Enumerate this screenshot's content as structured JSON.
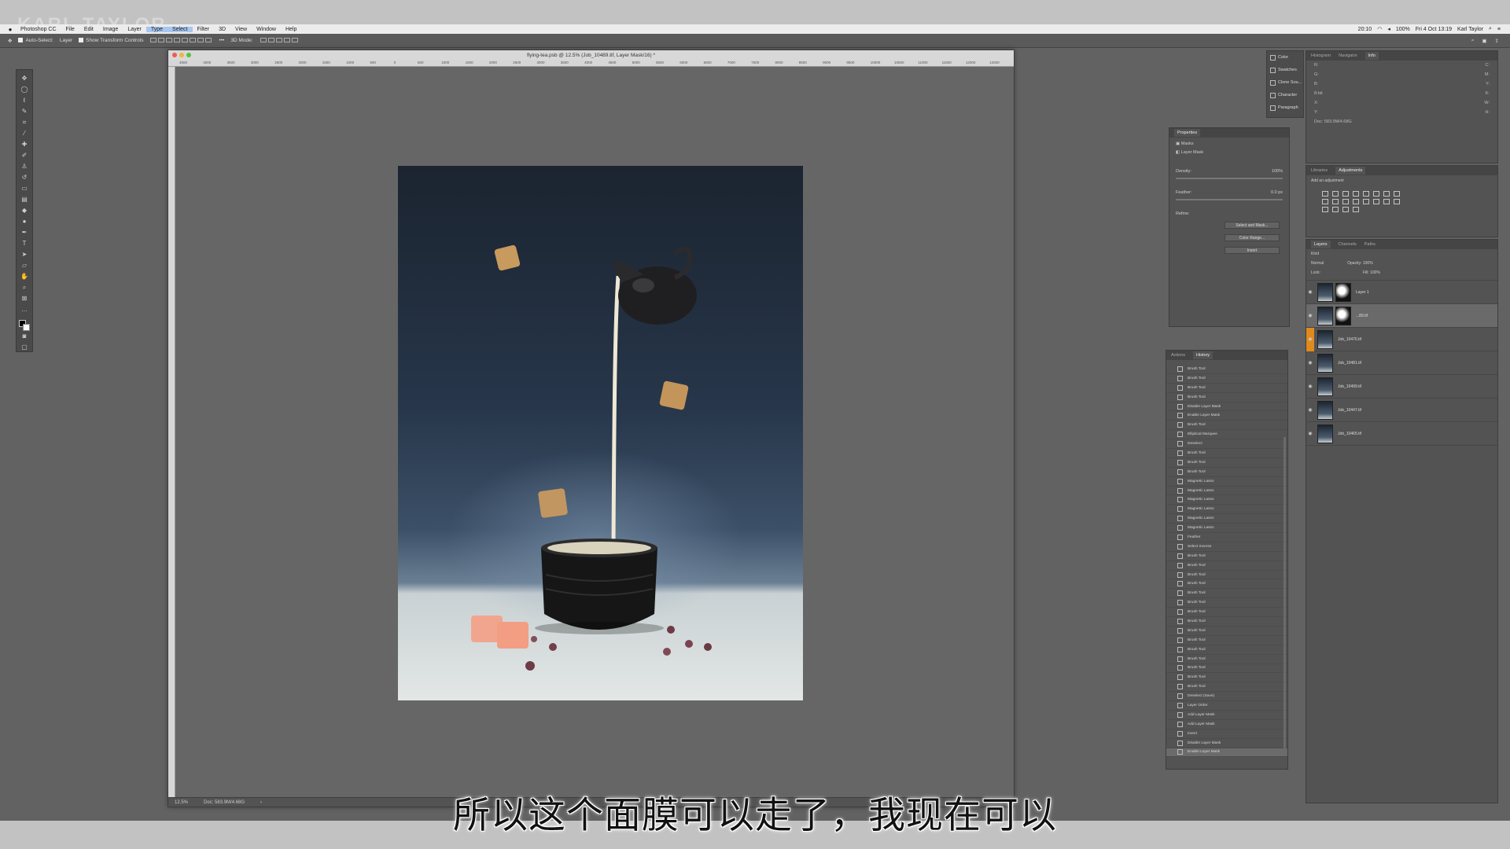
{
  "watermark": "KARL TAYLOR",
  "menubar": {
    "items": [
      "Photoshop CC",
      "File",
      "Edit",
      "Image",
      "Layer",
      "Type",
      "Select",
      "Filter",
      "3D",
      "View",
      "Window",
      "Help"
    ],
    "status": {
      "time_small": "20:10",
      "battery": "100%",
      "date": "Fri 4 Oct 13:19",
      "user": "Karl Taylor"
    }
  },
  "optionsbar": {
    "auto_select": "Auto-Select:",
    "layer_select": "Layer",
    "transform": "Show Transform Controls",
    "mode3d": "3D Mode:"
  },
  "document": {
    "title": "flying-tea.psb @ 12.5% (Job_10489.tif, Layer Mask/16) *",
    "zoom": "12.5%",
    "doc_size": "Doc: 583.9M/4.68G",
    "ruler_labels": [
      "4500",
      "4000",
      "3500",
      "3000",
      "2500",
      "2000",
      "1500",
      "1000",
      "500",
      "0",
      "500",
      "1000",
      "1500",
      "2000",
      "2500",
      "3000",
      "3500",
      "4000",
      "4500",
      "5000",
      "5500",
      "6000",
      "6500",
      "7000",
      "7500",
      "8000",
      "8500",
      "9000",
      "9500",
      "10000",
      "10500",
      "11000",
      "11500",
      "12000",
      "12500"
    ]
  },
  "dock": {
    "items": [
      "Color",
      "Swatches",
      "Clone Sou...",
      "Character",
      "Paragraph"
    ]
  },
  "info_panel": {
    "tabs": [
      "Histogram",
      "Navigator",
      "Info"
    ],
    "rows": [
      "R:",
      "C:",
      "G:",
      "M:",
      "B:",
      "Y:",
      "8-bit",
      "K:",
      "X:",
      "W:",
      "Y:",
      "H:"
    ],
    "doc": "Doc: 583.9M/4.68G"
  },
  "properties": {
    "tab": "Properties",
    "masks_label": "Masks",
    "layer_mask_label": "Layer Mask",
    "density_label": "Density:",
    "density_value": "100%",
    "feather_label": "Feather:",
    "feather_value": "0.0 px",
    "refine_label": "Refine:",
    "buttons": [
      "Select and Mask...",
      "Color Range...",
      "Invert"
    ]
  },
  "adjustments": {
    "tabs": [
      "Libraries",
      "Adjustments"
    ],
    "hint": "Add an adjustment"
  },
  "history": {
    "tabs": [
      "Actions",
      "History"
    ],
    "items": [
      "Brush Tool",
      "Brush Tool",
      "Brush Tool",
      "Brush Tool",
      "Disable Layer Mask",
      "Enable Layer Mask",
      "Brush Tool",
      "Elliptical Marquee",
      "Deselect",
      "Brush Tool",
      "Brush Tool",
      "Brush Tool",
      "Magnetic Lasso",
      "Magnetic Lasso",
      "Magnetic Lasso",
      "Magnetic Lasso",
      "Magnetic Lasso",
      "Magnetic Lasso",
      "Feather",
      "Select Inverse",
      "Brush Tool",
      "Brush Tool",
      "Brush Tool",
      "Brush Tool",
      "Brush Tool",
      "Brush Tool",
      "Brush Tool",
      "Brush Tool",
      "Brush Tool",
      "Brush Tool",
      "Brush Tool",
      "Brush Tool",
      "Brush Tool",
      "Brush Tool",
      "Brush Tool",
      "Deselect (Save)",
      "Layer Order",
      "Add Layer Mask",
      "Add Layer Mask",
      "Invert",
      "Disable Layer Mask",
      "Enable Layer Mask"
    ]
  },
  "layers": {
    "tabs": [
      "Layers",
      "Channels",
      "Paths"
    ],
    "kind": "Kind",
    "blend": "Normal",
    "opacity_label": "Opacity:",
    "opacity_value": "100%",
    "lock_label": "Lock:",
    "fill_label": "Fill:",
    "fill_value": "100%",
    "rows": [
      "Layer 1",
      "...89.tif",
      "Job_10476.tif",
      "Job_10481.tif",
      "Job_10499.tif",
      "Job_10447.tif",
      "Job_10465.tif"
    ]
  },
  "subtitle": "所以这个面膜可以走了，我现在可以",
  "colors": {
    "workspace": "#626262",
    "panel": "#535353",
    "accent_orange": "#e08a1e"
  }
}
